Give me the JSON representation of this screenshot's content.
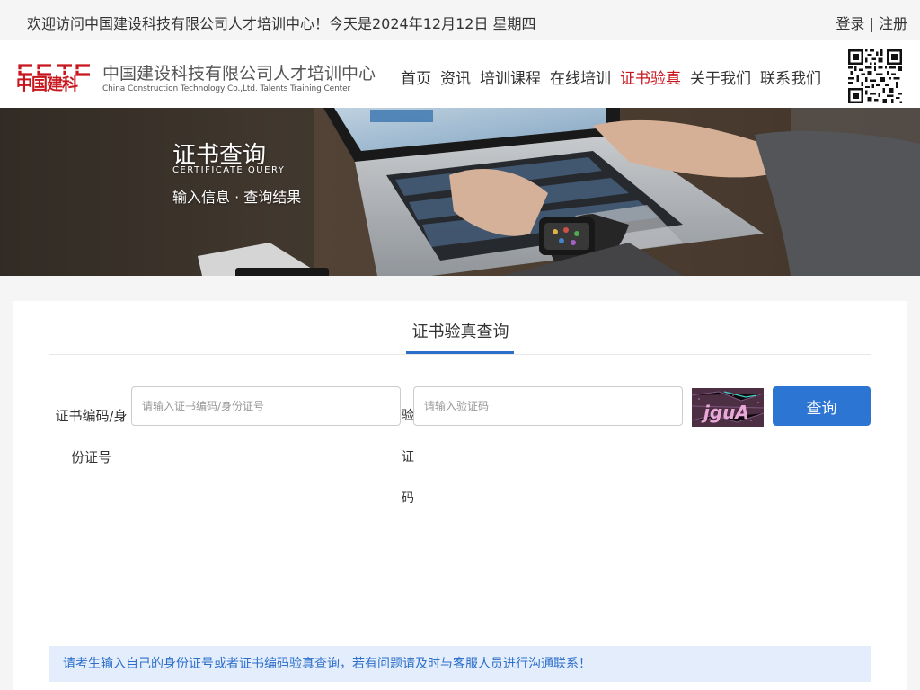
{
  "topbar": {
    "welcome": "欢迎访问中国建设科技有限公司人才培训中心！今天是2024年12月12日 星期四",
    "login": "登录",
    "separator": " | ",
    "register": "注册"
  },
  "logo": {
    "mark_text": "中国建科",
    "name_cn": "中国建设科技有限公司人才培训中心",
    "name_en": "China Construction Technology Co.,Ltd. Talents Training Center",
    "brand_color": "#c8161d"
  },
  "nav": {
    "items": [
      {
        "label": "首页"
      },
      {
        "label": "资讯"
      },
      {
        "label": "培训课程"
      },
      {
        "label": "在线培训"
      },
      {
        "label": "证书验真",
        "active": true
      },
      {
        "label": "关于我们"
      },
      {
        "label": "联系我们"
      }
    ]
  },
  "banner": {
    "title": "证书查询",
    "subtitle": "CERTIFICATE QUERY",
    "crumb": "输入信息 · 查询结果"
  },
  "form": {
    "tab_label": "证书验真查询",
    "cert_label": "证书编码/身份证号",
    "cert_placeholder": "请输入证书编码/身份证号",
    "cert_value": "",
    "code_label": "验证码",
    "code_placeholder": "请输入验证码",
    "code_value": "",
    "captcha_text": "jguA",
    "query_button": "查询"
  },
  "notice": "请考生输入自己的身份证号或者证书编码验真查询，若有问题请及时与客服人员进行沟通联系！",
  "colors": {
    "accent": "#2c75d3",
    "active_nav": "#c8161d",
    "notice_bg": "#e4edfb"
  }
}
